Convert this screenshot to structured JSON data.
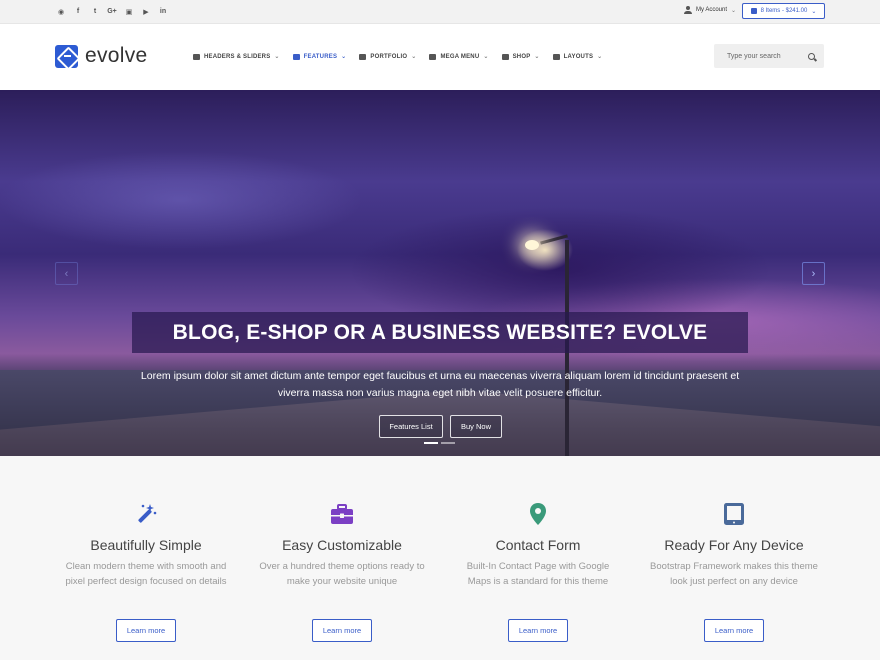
{
  "topbar": {
    "social": [
      "rss-icon",
      "facebook-icon",
      "twitter-icon",
      "googleplus-icon",
      "instagram-icon",
      "youtube-icon",
      "linkedin-icon"
    ],
    "social_glyphs": [
      "◉",
      "f",
      "t",
      "G+",
      "▣",
      "▶",
      "in"
    ],
    "account_label": "My Account",
    "cart_label": "8 Items - $241.00"
  },
  "header": {
    "logo_text": "evolve",
    "nav": [
      {
        "label": "HEADERS & SLIDERS"
      },
      {
        "label": "FEATURES"
      },
      {
        "label": "PORTFOLIO"
      },
      {
        "label": "MEGA MENU"
      },
      {
        "label": "SHOP"
      },
      {
        "label": "LAYOUTS"
      }
    ],
    "active_nav": "FEATURES",
    "search_placeholder": "Type your search"
  },
  "hero": {
    "title": "BLOG, E-SHOP OR A BUSINESS WEBSITE? EVOLVE",
    "description": "Lorem ipsum dolor sit amet dictum ante tempor eget faucibus et urna eu maecenas viverra aliquam lorem id tincidunt praesent et viverra massa non varius magna eget nibh vitae velit posuere efficitur.",
    "button_1": "Features List",
    "button_2": "Buy Now"
  },
  "features": [
    {
      "icon": "magic-wand-icon",
      "title": "Beautifully Simple",
      "text": "Clean modern theme with smooth and pixel perfect design focused on details",
      "button": "Learn more"
    },
    {
      "icon": "toolbox-icon",
      "title": "Easy Customizable",
      "text": "Over a hundred theme options ready to make your website unique",
      "button": "Learn more"
    },
    {
      "icon": "map-marker-icon",
      "title": "Contact Form",
      "text": "Built-In Contact Page with Google Maps is a standard for this theme",
      "button": "Learn more"
    },
    {
      "icon": "tablet-icon",
      "title": "Ready For Any Device",
      "text": "Bootstrap Framework makes this theme look just perfect on any device",
      "button": "Learn more"
    }
  ],
  "colors": {
    "accent": "#3a5dc8",
    "icon_blue": "#3a5dc8",
    "icon_purple": "#7b3fc4",
    "icon_green": "#3a9a7a",
    "icon_slate": "#4a6a9a"
  }
}
